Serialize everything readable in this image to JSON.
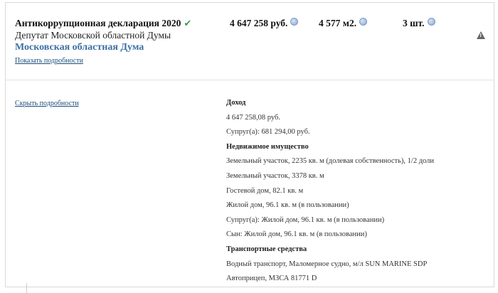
{
  "declaration": {
    "title": "Антикоррупционная декларация 2020",
    "position": "Депутат Московской областной Думы",
    "organization": "Московская областная Дума",
    "show_details": "Показать подробности",
    "hide_details": "Скрыть подробности",
    "income_total": "4 647 258 руб.",
    "area_total": "4 577 м2.",
    "vehicles_total": "3 шт."
  },
  "details": {
    "income_heading": "Доход",
    "income_items": [
      "4 647 258,08 руб.",
      "Супруг(а): 681 294,00 руб."
    ],
    "realestate_heading": "Недвижимое имущество",
    "realestate_items": [
      "Земельный участок, 2235 кв. м (долевая собственность), 1/2 доли",
      "Земельный участок, 3378 кв. м",
      "Гостевой дом, 82.1 кв. м",
      "Жилой дом, 96.1 кв. м (в пользовании)",
      "Супруг(а): Жилой дом, 96.1 кв. м (в пользовании)",
      "Сын: Жилой дом, 96.1 кв. м (в пользовании)"
    ],
    "transport_heading": "Транспортные средства",
    "transport_items": [
      "Водный транспорт, Маломерное судно, м/л SUN MARINE SDP",
      "Автоприцеп, МЗСА 81771 D"
    ]
  },
  "icons": {
    "verified": "check-icon",
    "info": "info-icon",
    "warning": "warning-icon"
  },
  "colors": {
    "organization_link": "#3e6fa3",
    "verified_check": "#3aa04a",
    "link": "#1a4c7a"
  }
}
